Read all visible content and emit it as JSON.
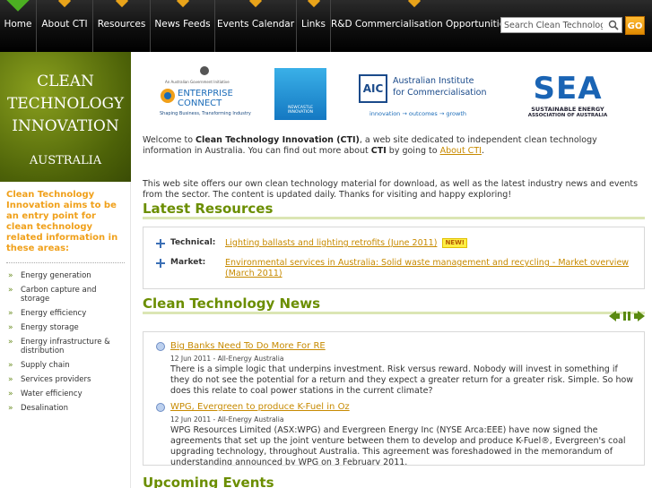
{
  "nav": {
    "home": "Home",
    "about": "About CTI",
    "resources": "Resources",
    "news_feeds": "News Feeds",
    "events": "Events Calendar",
    "links": "Links",
    "rd": "R&D Commercialisation Opportunities",
    "search_value": "Search Clean Technolog",
    "go": "GO"
  },
  "banner": {
    "line1": "CLEAN",
    "line2": "TECHNOLOGY",
    "line3": "INNOVATION",
    "line4": "AUSTRALIA"
  },
  "sidebar": {
    "tagline": "Clean Technology Innovation aims to be an entry point for clean technology related information in these areas:",
    "items": [
      "Energy generation",
      "Carbon capture and storage",
      "Energy efficiency",
      "Energy storage",
      "Energy infrastructure & distribution",
      "Supply chain",
      "Services providers",
      "Water efficiency",
      "Desalination"
    ]
  },
  "logos": {
    "gov_small": "An Australian Government Initiative",
    "enterprise": "ENTERPRISE",
    "connect": "CONNECT",
    "enterprise_tag": "Shaping Business, Transforming Industry",
    "newcastle": "NEWCASTLE\nINNOVATION",
    "aic_abbr": "AIC",
    "aic_name1": "Australian Institute",
    "aic_name2": "for Commercialisation",
    "aic_tag": "innovation → outcomes → growth",
    "sea_abbr": "SEA",
    "sea_name1": "SUSTAINABLE ENERGY",
    "sea_name2": "ASSOCIATION OF AUSTRALIA"
  },
  "intro": {
    "p1a": "Welcome to ",
    "p1b": "Clean Technology Innovation (CTI)",
    "p1c": ", a web site dedicated to independent clean technology information in Australia. You can find out more about ",
    "p1d": "CTI",
    "p1e": " by going to ",
    "p1link": "About CTI",
    "p1f": ".",
    "p2": "This web site offers our own clean technology material for download, as well as the latest industry news and events from the sector. The content is updated daily. Thanks for visiting and happy exploring!"
  },
  "latest_resources": {
    "title": "Latest Resources",
    "items": [
      {
        "type": "Technical:",
        "link": "Lighting ballasts and lighting retrofits (June 2011)",
        "badge": "NEW!"
      },
      {
        "type": "Market:",
        "link": "Environmental services in Australia: Solid waste management and recycling - Market overview (March 2011)",
        "badge": ""
      }
    ]
  },
  "news": {
    "title": "Clean Technology News",
    "items": [
      {
        "title": "Big Banks Need To Do More For RE",
        "meta": "12 Jun 2011 - All-Energy Australia",
        "body": "There is a simple logic that underpins investment. Risk versus reward. Nobody will invest in something if they do not see the potential for a return and they expect a greater return for a greater risk. Simple. So how does this relate to coal power stations in the current climate?"
      },
      {
        "title": "WPG, Evergreen to produce K-Fuel in Oz",
        "meta": "12 Jun 2011 - All-Energy Australia",
        "body": "WPG Resources Limited (ASX:WPG) and Evergreen Energy Inc (NYSE Arca:EEE) have now signed the agreements that set up the joint venture between them to develop and produce K-Fuel®, Evergreen's coal upgrading technology, throughout Australia. This agreement was foreshadowed in the memorandum of understanding announced by WPG on 3 February 2011."
      }
    ]
  },
  "events": {
    "title": "Upcoming Events"
  },
  "colors": {
    "accent_green": "#6b8e00",
    "link_orange": "#c78a00",
    "tagline_orange": "#f0a01a"
  }
}
